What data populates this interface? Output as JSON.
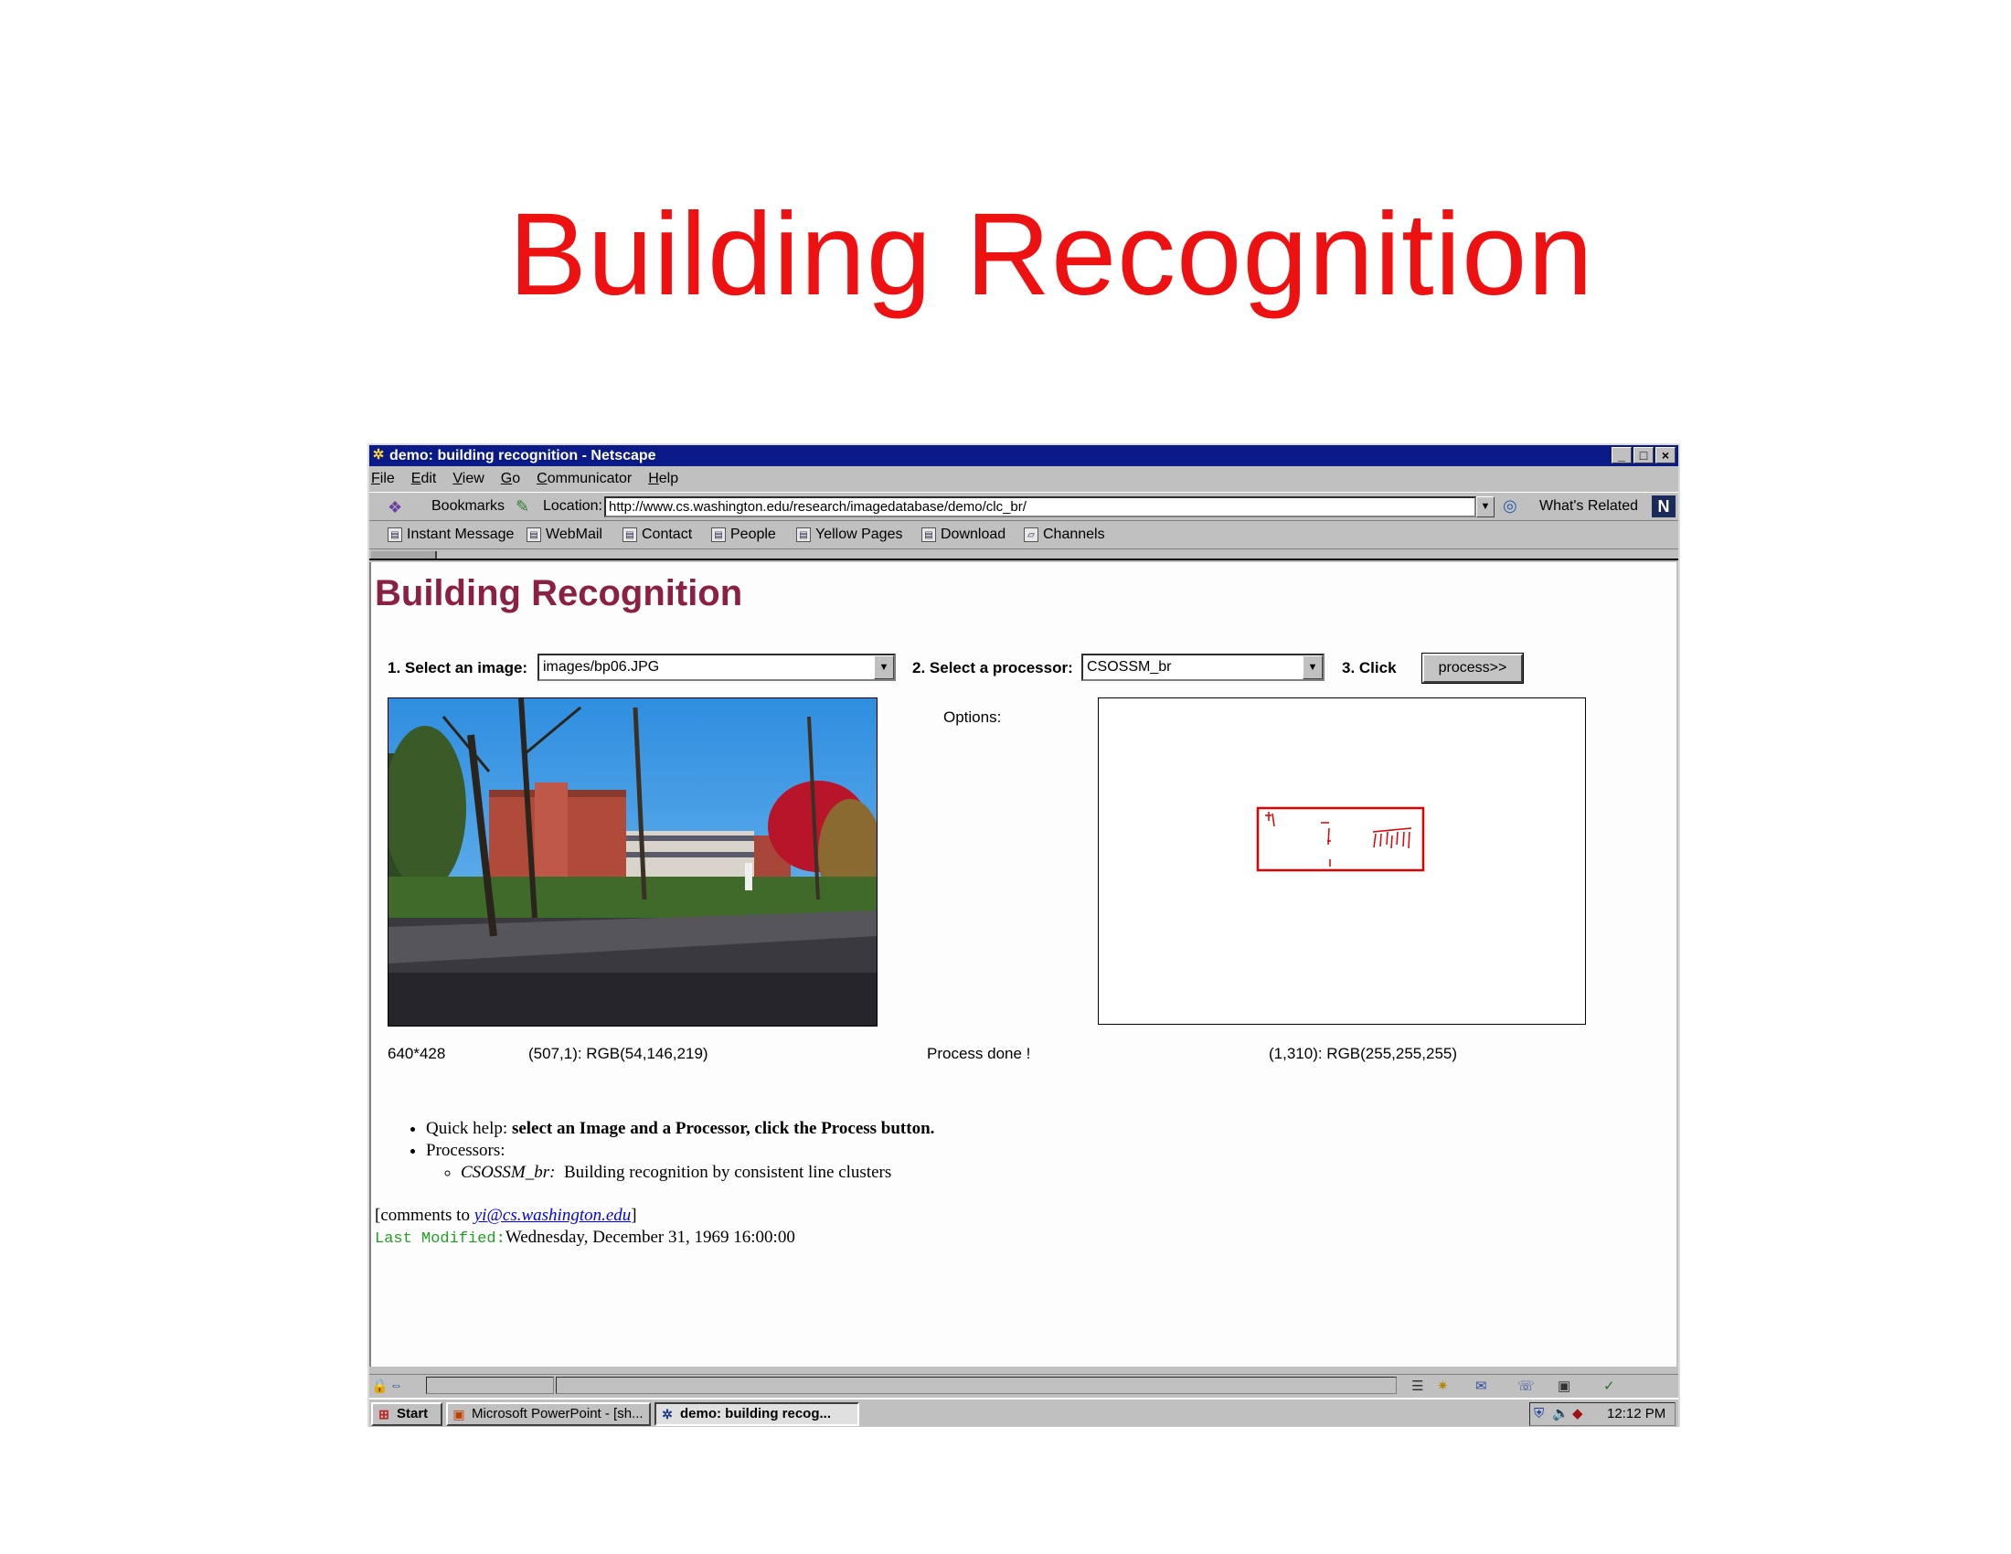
{
  "slide": {
    "title": "Building Recognition"
  },
  "window": {
    "title": "demo: building recognition - Netscape",
    "controls": {
      "minimize": "_",
      "maximize": "□",
      "close": "×"
    }
  },
  "menu": [
    "File",
    "Edit",
    "View",
    "Go",
    "Communicator",
    "Help"
  ],
  "navbar": {
    "bookmarks_label": "Bookmarks",
    "location_label": "Location:",
    "url": "http://www.cs.washington.edu/research/imagedatabase/demo/clc_br/",
    "whats_related": "What's Related",
    "logo": "N"
  },
  "personal_toolbar": [
    "Instant Message",
    "WebMail",
    "Contact",
    "People",
    "Yellow Pages",
    "Download",
    "Channels"
  ],
  "page": {
    "heading": "Building Recognition",
    "step1_label": "1. Select an image:",
    "image_select": "images/bp06.JPG",
    "step2_label": "2. Select a processor:",
    "processor_select": "CSOSSM_br",
    "step3_label": "3. Click",
    "process_button": "process>>",
    "options_label": "Options:",
    "image_size": "640*428",
    "pixel_info_left": "(507,1): RGB(54,146,219)",
    "status": "Process done !",
    "pixel_info_right": "(1,310): RGB(255,255,255)",
    "help": {
      "quick_prefix": "Quick help:",
      "quick_text": "select an Image and a Processor, click the Process button.",
      "processors_label": "Processors:",
      "processor_name": "CSOSSM_br:",
      "processor_desc": "Building recognition by consistent line clusters"
    },
    "comments_prefix": "[comments to",
    "comments_email": "yi@cs.washington.edu",
    "comments_suffix": "]",
    "last_modified_label": "Last Modified:",
    "last_modified_value": "Wednesday, December 31, 1969 16:00:00"
  },
  "taskbar": {
    "start": "Start",
    "items": [
      "Microsoft PowerPoint - [sh...",
      "demo: building recog..."
    ],
    "clock": "12:12 PM"
  },
  "colors": {
    "slide_title": "#ee1111",
    "titlebar": "#0a1a86",
    "page_heading": "#8c1f44",
    "last_modified_label": "#20a020",
    "link": "#0000ee",
    "detection_box": "#e00000"
  },
  "icons": {
    "titlebar": "netscape-icon",
    "bookmarks": "bookmarks-icon",
    "location": "location-icon",
    "whats_related": "whats-related-icon",
    "start": "windows-logo-icon"
  }
}
